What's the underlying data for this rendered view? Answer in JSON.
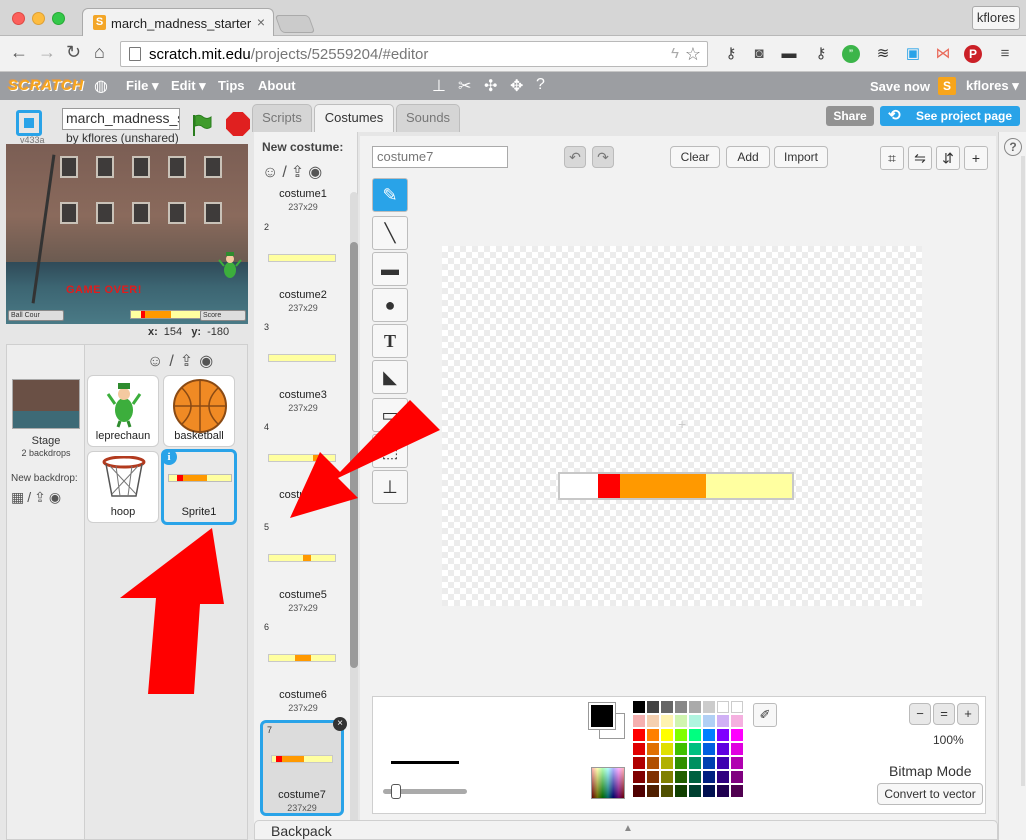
{
  "browser": {
    "tab_title": "march_madness_starter re",
    "tab_close": "×",
    "url_domain": "scratch.mit.edu",
    "url_path": "/projects/52559204/#editor",
    "user_button": "kflores"
  },
  "menubar": {
    "logo": "SCRATCH",
    "file": "File ▾",
    "edit": "Edit ▾",
    "tips": "Tips",
    "about": "About",
    "save_now": "Save now",
    "user": "kflores ▾"
  },
  "stage": {
    "version": "v433a",
    "project_title": "march_madness_s",
    "by_line": "by kflores (unshared)",
    "game_over": "GAME OVER!",
    "readout_left": "Ball Cour",
    "readout_right": "Score",
    "x_label": "x:",
    "x_value": "154",
    "y_label": "y:",
    "y_value": "-180"
  },
  "sprites_panel": {
    "stage_label": "Stage",
    "stage_sub": "2 backdrops",
    "new_backdrop": "New backdrop:",
    "sprites": [
      {
        "name": "leprechaun"
      },
      {
        "name": "basketball"
      },
      {
        "name": "hoop"
      },
      {
        "name": "Sprite1"
      }
    ]
  },
  "editor_tabs": {
    "scripts": "Scripts",
    "costumes": "Costumes",
    "sounds": "Sounds",
    "share": "Share",
    "see_project": "See project page"
  },
  "costumes": {
    "new_costume": "New costume:",
    "items": [
      {
        "num": "",
        "name": "costume1",
        "size": "237x29"
      },
      {
        "num": "2",
        "name": "costume2",
        "size": "237x29"
      },
      {
        "num": "3",
        "name": "costume3",
        "size": "237x29"
      },
      {
        "num": "4",
        "name": "costume4",
        "size": ""
      },
      {
        "num": "5",
        "name": "costume5",
        "size": "237x29"
      },
      {
        "num": "6",
        "name": "costume6",
        "size": "237x29"
      },
      {
        "num": "7",
        "name": "costume7",
        "size": "237x29"
      }
    ]
  },
  "paint_editor": {
    "costume_name": "costume7",
    "clear": "Clear",
    "add": "Add",
    "import": "Import",
    "zoom": "100%",
    "mode": "Bitmap Mode",
    "convert": "Convert to vector"
  },
  "backpack": {
    "label": "Backpack"
  },
  "colors": {
    "accent": "#29a3e8",
    "bar_red": "#ff0000",
    "bar_orange": "#ff9900",
    "bar_yellow": "#ffffa0",
    "arrow_red": "#ff0000"
  }
}
